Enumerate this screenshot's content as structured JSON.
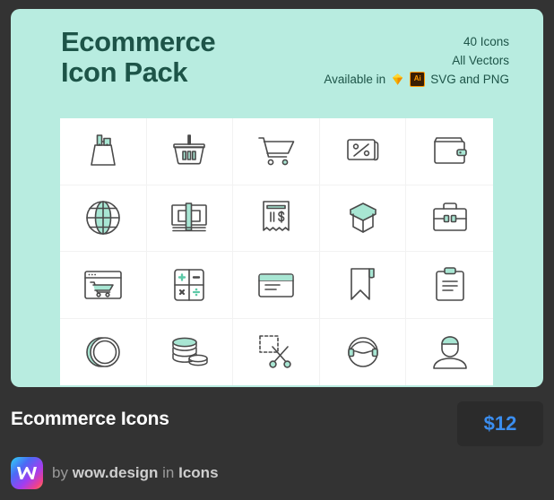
{
  "hero": {
    "title": "Ecommerce\nIcon Pack",
    "stats": {
      "count": "40 Icons",
      "vectors": "All Vectors",
      "available_prefix": "Available in",
      "available_suffix": "SVG and PNG",
      "sketch_icon": "sketch-diamond-icon",
      "illustrator_icon": "adobe-illustrator-icon",
      "illustrator_label": "Ai"
    },
    "colors": {
      "background": "#b8ece0",
      "text": "#1d5448"
    }
  },
  "grid": {
    "panel_background": "#ffffff",
    "divider": "#f2f2f2",
    "stroke": "#4a4a4a",
    "accent": "#a8e6d3",
    "icons": [
      {
        "name": "shopping-bag-icon",
        "label": "Shopping Bag"
      },
      {
        "name": "shopping-basket-icon",
        "label": "Shopping Basket"
      },
      {
        "name": "shopping-cart-icon",
        "label": "Shopping Cart"
      },
      {
        "name": "discount-percent-icon",
        "label": "Discount Tag"
      },
      {
        "name": "wallet-icon",
        "label": "Wallet"
      },
      {
        "name": "globe-icon",
        "label": "Global Commerce"
      },
      {
        "name": "cash-stack-icon",
        "label": "Cash Bundle"
      },
      {
        "name": "receipt-icon",
        "label": "Receipt"
      },
      {
        "name": "open-box-icon",
        "label": "Open Box"
      },
      {
        "name": "briefcase-icon",
        "label": "Briefcase"
      },
      {
        "name": "online-store-icon",
        "label": "Online Store"
      },
      {
        "name": "calculator-icon",
        "label": "Calculator"
      },
      {
        "name": "credit-card-icon",
        "label": "Credit Card"
      },
      {
        "name": "bookmark-icon",
        "label": "Bookmark"
      },
      {
        "name": "clipboard-icon",
        "label": "Clipboard List"
      },
      {
        "name": "coin-icon",
        "label": "Coin"
      },
      {
        "name": "coins-stack-icon",
        "label": "Coin Stack"
      },
      {
        "name": "scissors-coupon-icon",
        "label": "Coupon Scissors"
      },
      {
        "name": "customer-support-icon",
        "label": "Support Agent"
      },
      {
        "name": "user-profile-icon",
        "label": "Customer Profile"
      }
    ]
  },
  "footer": {
    "product_title": "Ecommerce Icons",
    "price": "$12",
    "byline_prefix": "by",
    "author": "wow.design",
    "byline_middle": "in",
    "category": "Icons",
    "logo_name": "wow-design-logo",
    "colors": {
      "background": "#333333",
      "price_text": "#3b8ef0",
      "price_badge": "#2b2b2b"
    }
  }
}
